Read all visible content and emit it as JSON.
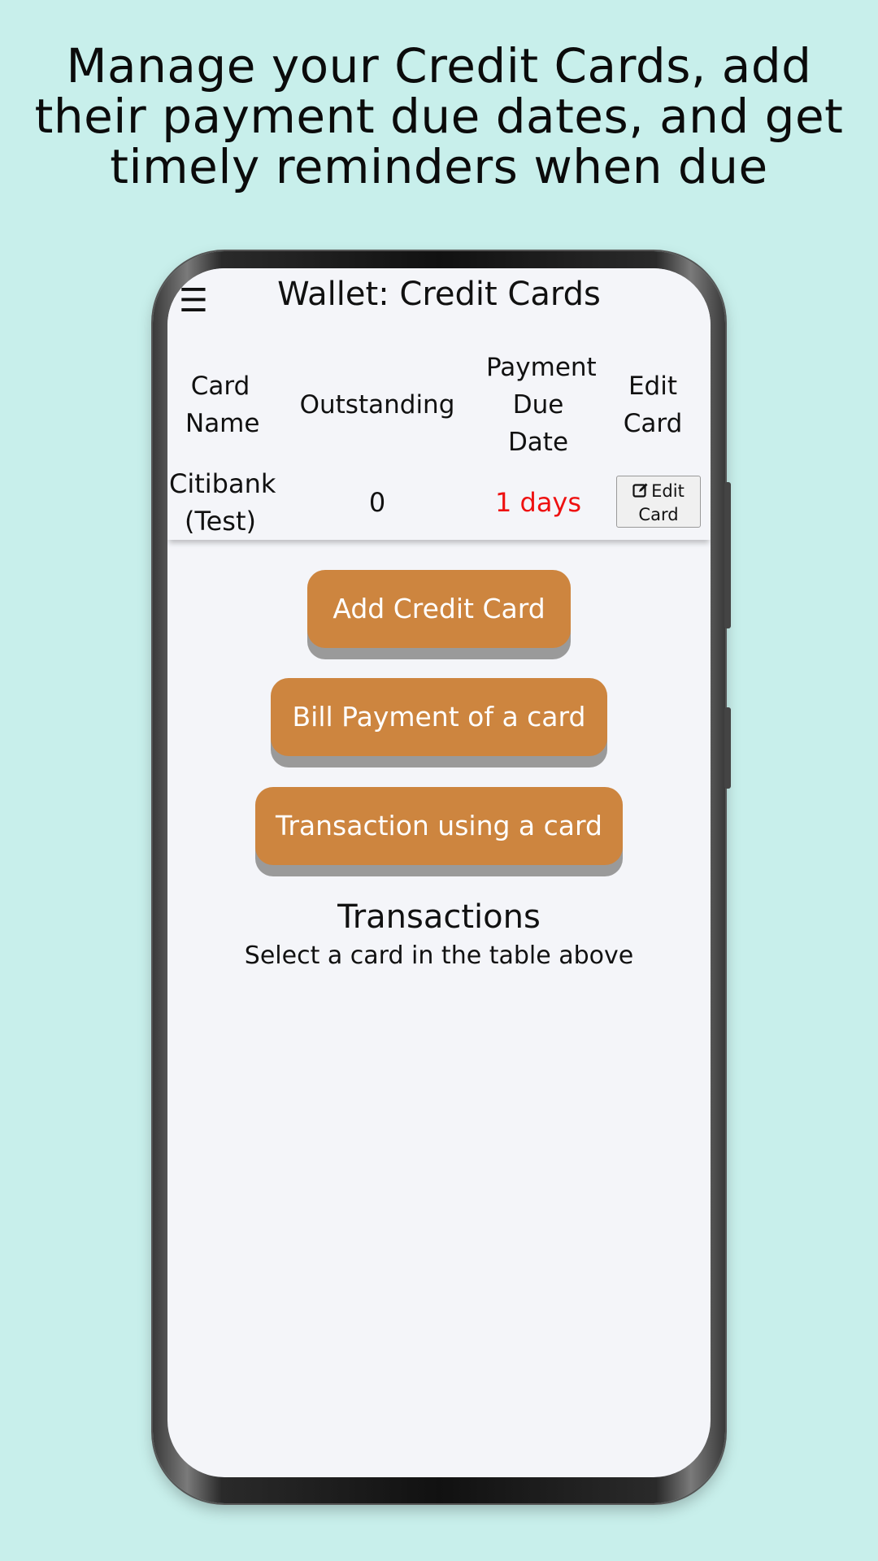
{
  "promo": {
    "headline_line1": "Manage your Credit Cards, add",
    "headline_line2": "their payment due dates, and get",
    "headline_line3": "timely reminders when due"
  },
  "appbar": {
    "menu_icon": "hamburger-icon",
    "menu_glyph": "☰",
    "title": "Wallet: Credit Cards"
  },
  "table": {
    "headers": {
      "card_name": "Card Name",
      "outstanding": "Outstanding",
      "due_date": "Payment Due Date",
      "edit": "Edit Card"
    },
    "rows": [
      {
        "card_name": "Citibank (Test)",
        "outstanding": "0",
        "due_date": "1 days",
        "edit_label": "Edit Card",
        "edit_icon": "edit-icon"
      }
    ]
  },
  "actions": {
    "add_card": "Add Credit Card",
    "bill_payment": "Bill Payment of a card",
    "transaction": "Transaction using a card"
  },
  "transactions": {
    "title": "Transactions",
    "hint": "Select a card in the table above"
  },
  "colors": {
    "page_background": "#c8efeb",
    "screen_background": "#f4f5f9",
    "button_primary": "#cd853f",
    "button_shadow": "#9a9a9a",
    "due_text": "#e11111"
  }
}
